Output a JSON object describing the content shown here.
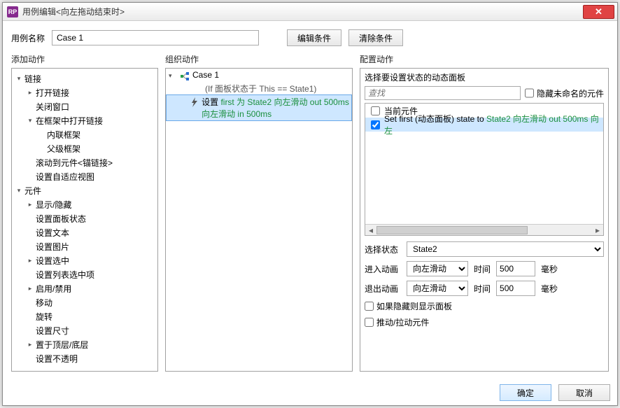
{
  "window": {
    "app_icon_text": "RP",
    "title": "用例编辑<向左拖动结束时>"
  },
  "case_name": {
    "label": "用例名称",
    "value": "Case 1",
    "edit_condition_btn": "编辑条件",
    "clear_condition_btn": "清除条件"
  },
  "columns": {
    "add_action": "添加动作",
    "organize": "组织动作",
    "configure": "配置动作"
  },
  "action_tree": [
    {
      "d": 0,
      "arrow": "▾",
      "label": "链接"
    },
    {
      "d": 1,
      "arrow": "▸",
      "label": "打开链接"
    },
    {
      "d": 1,
      "arrow": "",
      "label": "关闭窗口"
    },
    {
      "d": 1,
      "arrow": "▾",
      "label": "在框架中打开链接"
    },
    {
      "d": 2,
      "arrow": "",
      "label": "内联框架"
    },
    {
      "d": 2,
      "arrow": "",
      "label": "父级框架"
    },
    {
      "d": 1,
      "arrow": "",
      "label": "滚动到元件<锚链接>"
    },
    {
      "d": 1,
      "arrow": "",
      "label": "设置自适应视图"
    },
    {
      "d": 0,
      "arrow": "▾",
      "label": "元件"
    },
    {
      "d": 1,
      "arrow": "▸",
      "label": "显示/隐藏"
    },
    {
      "d": 1,
      "arrow": "",
      "label": "设置面板状态"
    },
    {
      "d": 1,
      "arrow": "",
      "label": "设置文本"
    },
    {
      "d": 1,
      "arrow": "",
      "label": "设置图片"
    },
    {
      "d": 1,
      "arrow": "▸",
      "label": "设置选中"
    },
    {
      "d": 1,
      "arrow": "",
      "label": "设置列表选中项"
    },
    {
      "d": 1,
      "arrow": "▸",
      "label": "启用/禁用"
    },
    {
      "d": 1,
      "arrow": "",
      "label": "移动"
    },
    {
      "d": 1,
      "arrow": "",
      "label": "旋转"
    },
    {
      "d": 1,
      "arrow": "",
      "label": "设置尺寸"
    },
    {
      "d": 1,
      "arrow": "▸",
      "label": "置于顶层/底层"
    },
    {
      "d": 1,
      "arrow": "",
      "label": "设置不透明"
    }
  ],
  "organize": {
    "case_label": "Case 1",
    "case_condition": "(If 面板状态于 This == State1)",
    "action_prefix": "设置 ",
    "action_green": "first 为 State2 向左滑动 out 500ms 向左滑动 in 500ms"
  },
  "configure": {
    "header": "选择要设置状态的动态面板",
    "search_placeholder": "查找",
    "hide_unnamed_label": "隐藏未命名的元件",
    "items": [
      {
        "checked": false,
        "label": "当前元件"
      },
      {
        "checked": true,
        "prefix": "Set first (动态面板) state to ",
        "green": "State2 向左滑动 out 500ms 向左"
      }
    ],
    "select_state": {
      "label": "选择状态",
      "value": "State2"
    },
    "enter_anim": {
      "label": "进入动画",
      "anim": "向左滑动",
      "time_label": "时间",
      "time": "500",
      "unit": "毫秒"
    },
    "exit_anim": {
      "label": "退出动画",
      "anim": "向左滑动",
      "time_label": "时间",
      "time": "500",
      "unit": "毫秒"
    },
    "show_if_hidden": "如果隐藏则显示面板",
    "push_pull": "推动/拉动元件"
  },
  "footer": {
    "ok": "确定",
    "cancel": "取消"
  }
}
